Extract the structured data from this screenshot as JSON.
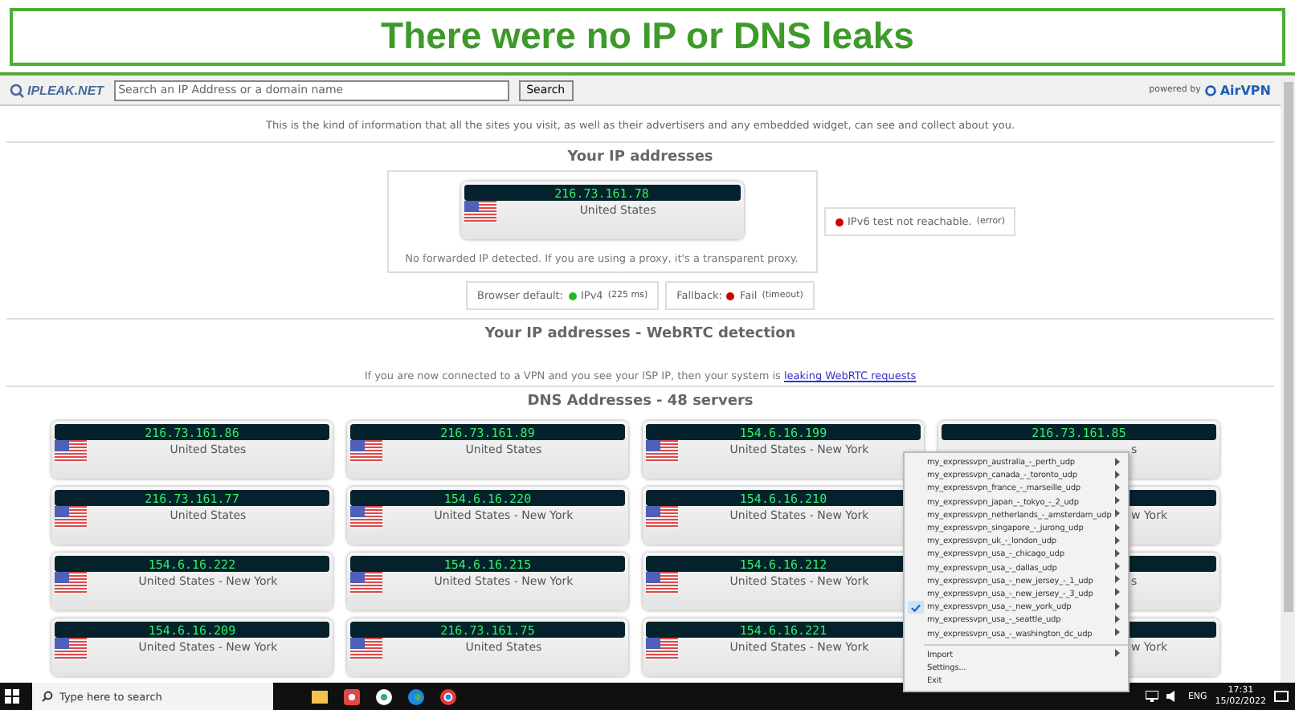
{
  "banner": {
    "title": "There were no IP or DNS leaks"
  },
  "browser": {
    "logo": "IPLEAK.NET",
    "search": {
      "placeholder": "Search an IP Address or a domain name",
      "button": "Search"
    },
    "powered_by": "powered by",
    "brand": "AirVPN"
  },
  "intro": "This is the kind of information that all the sites you visit, as well as their advertisers and any embedded widget, can see and collect about you.",
  "ip_section": {
    "heading": "Your IP addresses",
    "ip": "216.73.161.78",
    "country": "United States",
    "note": "No forwarded IP detected. If you are using a proxy, it's a transparent proxy.",
    "ipv6": {
      "text": "IPv6 test not reachable.",
      "detail": "(error)",
      "color": "#cc0000"
    },
    "tests": [
      {
        "label": "Browser default:",
        "value": "IPv4",
        "detail": "(225 ms)",
        "color": "#22bb22"
      },
      {
        "label": "Fallback:",
        "value": "Fail",
        "detail": "(timeout)",
        "color": "#cc0000"
      }
    ]
  },
  "webrtc": {
    "heading": "Your IP addresses - WebRTC detection",
    "text": "If you are now connected to a VPN and you see your ISP IP, then your system is ",
    "link": "leaking WebRTC requests"
  },
  "dns": {
    "heading": "DNS Addresses - 48 servers",
    "servers": [
      {
        "kind": "full",
        "ip": "216.73.161.86",
        "country": "United States"
      },
      {
        "kind": "full",
        "ip": "216.73.161.89",
        "country": "United States"
      },
      {
        "kind": "full",
        "ip": "154.6.16.199",
        "country": "United States - New York"
      },
      {
        "kind": "covered",
        "ip": "216.73.161.85",
        "country": "s"
      },
      {
        "kind": "full",
        "ip": "216.73.161.77",
        "country": "United States"
      },
      {
        "kind": "full",
        "ip": "154.6.16.220",
        "country": "United States - New York"
      },
      {
        "kind": "full",
        "ip": "154.6.16.210",
        "country": "United States - New York"
      },
      {
        "kind": "covered",
        "country": "w York"
      },
      {
        "kind": "full",
        "ip": "154.6.16.222",
        "country": "United States - New York"
      },
      {
        "kind": "full",
        "ip": "154.6.16.215",
        "country": "United States - New York"
      },
      {
        "kind": "full",
        "ip": "154.6.16.212",
        "country": "United States - New York"
      },
      {
        "kind": "covered",
        "country": "s"
      },
      {
        "kind": "full",
        "ip": "154.6.16.209",
        "country": "United States - New York"
      },
      {
        "kind": "full",
        "ip": "216.73.161.75",
        "country": "United States"
      },
      {
        "kind": "full",
        "ip": "154.6.16.221",
        "country": "United States - New York"
      },
      {
        "kind": "covered",
        "country": "w York"
      }
    ]
  },
  "context_menu": {
    "items": [
      {
        "label": "my_expressvpn_australia_-_perth_udp",
        "checked": false,
        "submenu": true
      },
      {
        "label": "my_expressvpn_canada_-_toronto_udp",
        "checked": false,
        "submenu": true
      },
      {
        "label": "my_expressvpn_france_-_marseille_udp",
        "checked": false,
        "submenu": true
      },
      {
        "label": "my_expressvpn_japan_-_tokyo_-_2_udp",
        "checked": false,
        "submenu": true
      },
      {
        "label": "my_expressvpn_netherlands_-_amsterdam_udp",
        "checked": false,
        "submenu": true
      },
      {
        "label": "my_expressvpn_singapore_-_jurong_udp",
        "checked": false,
        "submenu": true
      },
      {
        "label": "my_expressvpn_uk_-_london_udp",
        "checked": false,
        "submenu": true
      },
      {
        "label": "my_expressvpn_usa_-_chicago_udp",
        "checked": false,
        "submenu": true
      },
      {
        "label": "my_expressvpn_usa_-_dallas_udp",
        "checked": false,
        "submenu": true
      },
      {
        "label": "my_expressvpn_usa_-_new_jersey_-_1_udp",
        "checked": false,
        "submenu": true
      },
      {
        "label": "my_expressvpn_usa_-_new_jersey_-_3_udp",
        "checked": false,
        "submenu": true
      },
      {
        "label": "my_expressvpn_usa_-_new_york_udp",
        "checked": true,
        "submenu": true
      },
      {
        "label": "my_expressvpn_usa_-_seattle_udp",
        "checked": false,
        "submenu": true
      },
      {
        "label": "my_expressvpn_usa_-_washington_dc_udp",
        "checked": false,
        "submenu": true
      }
    ],
    "actions": [
      {
        "label": "Import",
        "submenu": true
      },
      {
        "label": "Settings...",
        "submenu": false
      },
      {
        "label": "Exit",
        "submenu": false
      }
    ]
  },
  "taskbar": {
    "search_placeholder": "Type here to search",
    "language": "ENG",
    "time": "17:31",
    "date": "15/02/2022"
  }
}
